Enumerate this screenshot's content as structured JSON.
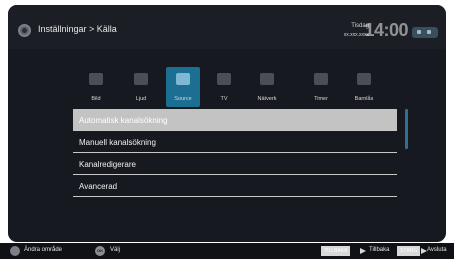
{
  "header": {
    "breadcrumb": "Inställningar > Källa",
    "clock": {
      "day": "Tisdag",
      "date": "xx.xxx.xxxx",
      "time": "14:00"
    }
  },
  "categories": [
    {
      "label": "Bild",
      "icon": "picture-icon",
      "active": false
    },
    {
      "label": "Ljud",
      "icon": "speaker-icon",
      "active": false
    },
    {
      "label": "Source",
      "icon": "source-icon",
      "active": true
    },
    {
      "label": "TV",
      "icon": "tv-icon",
      "active": false
    },
    {
      "label": "Nätverk",
      "icon": "network-icon",
      "active": false
    },
    {
      "label": "Timer",
      "icon": "timer-icon",
      "active": false
    },
    {
      "label": "Barnlås",
      "icon": "child-lock-icon",
      "active": false
    }
  ],
  "menu": {
    "items": [
      {
        "label": "Automatisk kanalsökning",
        "selected": true
      },
      {
        "label": "Manuell kanalsökning",
        "selected": false
      },
      {
        "label": "Kanalredigerare",
        "selected": false
      },
      {
        "label": "Avancerad",
        "selected": false
      }
    ]
  },
  "footer": {
    "change_area": "Ändra område",
    "ok_key": "OK",
    "select": "Välj",
    "back_key": "TILLBAKA",
    "back": "Tillbaka",
    "close_key": "STÄNG",
    "close": "Avsluta"
  },
  "colors": {
    "background": "#16191f",
    "accent": "#1c6e92",
    "selection": "#c3c3c3"
  }
}
